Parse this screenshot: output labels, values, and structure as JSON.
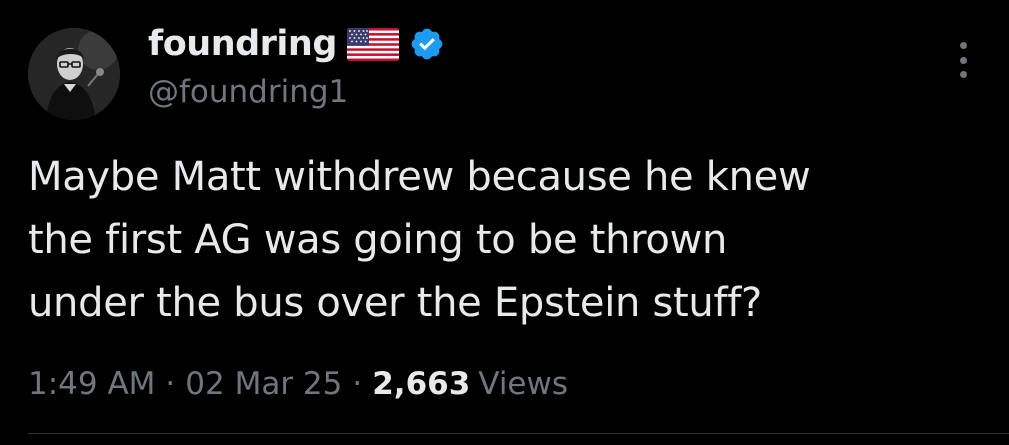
{
  "user": {
    "display_name": "foundring",
    "handle": "@foundring1",
    "flag_icon": "us-flag-icon",
    "verified_icon": "verified-badge-icon",
    "verified_color": "#1d9bf0"
  },
  "tweet": {
    "text_lines": [
      "Maybe Matt withdrew because he knew",
      "the first AG was going to be thrown",
      "under the bus over the Epstein stuff?"
    ]
  },
  "meta": {
    "time": "1:49 AM",
    "separator": "·",
    "date": "02 Mar 25",
    "views_count": "2,663",
    "views_label": "Views"
  },
  "colors": {
    "background": "#000000",
    "primary_text": "#e7e9ea",
    "secondary_text": "#71767b",
    "divider": "#2f3336"
  },
  "more_icon": "more-vertical-icon"
}
